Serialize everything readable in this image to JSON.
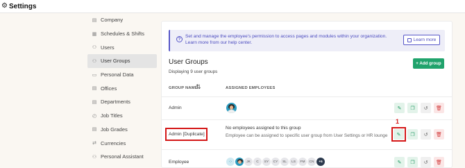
{
  "header": {
    "title": "Settings",
    "icon": "gear-icon"
  },
  "sidebar": {
    "items": [
      {
        "label": "Company",
        "icon": "building-icon",
        "glyph": "▤"
      },
      {
        "label": "Schedules & Shifts",
        "icon": "calendar-icon",
        "glyph": "▦"
      },
      {
        "label": "Users",
        "icon": "users-icon",
        "glyph": "⚇"
      },
      {
        "label": "User Groups",
        "icon": "user-group-icon",
        "glyph": "⚇",
        "active": true
      },
      {
        "label": "Personal Data",
        "icon": "id-card-icon",
        "glyph": "▭"
      },
      {
        "label": "Offices",
        "icon": "office-icon",
        "glyph": "▤"
      },
      {
        "label": "Departments",
        "icon": "department-icon",
        "glyph": "▤"
      },
      {
        "label": "Job Titles",
        "icon": "badge-icon",
        "glyph": "◴"
      },
      {
        "label": "Job Grades",
        "icon": "grade-icon",
        "glyph": "▤"
      },
      {
        "label": "Currencies",
        "icon": "exchange-icon",
        "glyph": "⇄"
      },
      {
        "label": "Personal Assistant",
        "icon": "assistant-icon",
        "glyph": "⚇"
      }
    ]
  },
  "info": {
    "text": "Set and manage the employee's permission to access pages and modules within your organization. Learn more from our help center.",
    "button": "Learn more"
  },
  "main": {
    "title": "User Groups",
    "subtitle": "Displaying 9 user groups",
    "add_button": "+ Add group",
    "columns": {
      "name": "GROUP NAME",
      "sort_icon": "⇅",
      "employees": "ASSIGNED EMPLOYEES"
    },
    "rows": [
      {
        "name": "Admin"
      },
      {
        "name": "Admin [Duplicate]",
        "empty_title": "No employees assigned to this group",
        "empty_desc": "Employee can be assigned to specific user group from User Settings or HR lounge"
      },
      {
        "name": "Employee",
        "avatars": [
          "JK",
          "C",
          "SY",
          "CY",
          "SL",
          "LS",
          "FM",
          "CN"
        ],
        "more": "+5"
      }
    ]
  },
  "annotation": {
    "step": "1"
  },
  "colors": {
    "accent": "#20a36c",
    "info": "#5656c8",
    "highlight": "#d41717"
  }
}
